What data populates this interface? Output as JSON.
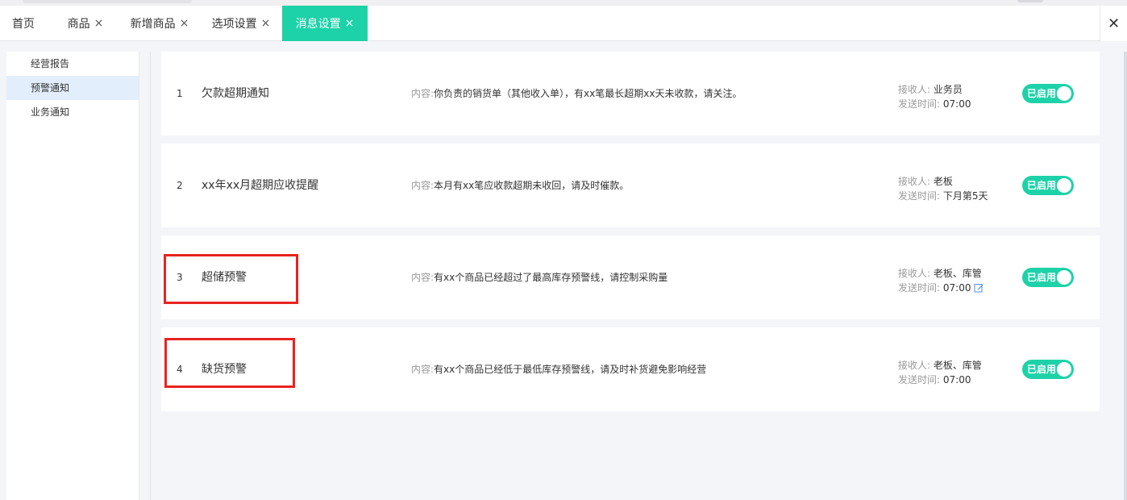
{
  "tabs": [
    {
      "label": "首页",
      "closable": false,
      "active": false
    },
    {
      "label": "商品",
      "closable": true,
      "active": false
    },
    {
      "label": "新增商品",
      "closable": true,
      "active": false
    },
    {
      "label": "选项设置",
      "closable": true,
      "active": false
    },
    {
      "label": "消息设置",
      "closable": true,
      "active": true
    }
  ],
  "tab_close_glyph": "×",
  "tab_close_all_glyph": "✕",
  "sidebar": {
    "items": [
      {
        "label": "经营报告",
        "active": false
      },
      {
        "label": "预警通知",
        "active": true
      },
      {
        "label": "业务通知",
        "active": false
      }
    ]
  },
  "content_label": "内容:",
  "receiver_label": "接收人:",
  "send_time_label": "发送时间:",
  "notifications": [
    {
      "index": "1",
      "title": "欠款超期通知",
      "content": "你负责的销货单（其他收入单），有xx笔最长超期xx天未收款，请关注。",
      "receiver": "业务员",
      "send_time": "07:00",
      "status": "已启用",
      "editable": false
    },
    {
      "index": "2",
      "title": "xx年xx月超期应收提醒",
      "content": "本月有xx笔应收款超期未收回，请及时催款。",
      "receiver": "老板",
      "send_time": "下月第5天",
      "status": "已启用",
      "editable": false
    },
    {
      "index": "3",
      "title": "超储预警",
      "content": "有xx个商品已经超过了最高库存预警线，请控制采购量",
      "receiver": "老板、库管",
      "send_time": "07:00",
      "status": "已启用",
      "editable": true
    },
    {
      "index": "4",
      "title": "缺货预警",
      "content": "有xx个商品已经低于最低库存预警线，请及时补货避免影响经营",
      "receiver": "老板、库管",
      "send_time": "07:00",
      "status": "已启用",
      "editable": false
    }
  ],
  "colors": {
    "accent": "#1dd2a8",
    "highlight_box": "#e8231f",
    "active_menu_bg": "#e3eefc",
    "page_bg": "#f4f5f9"
  }
}
